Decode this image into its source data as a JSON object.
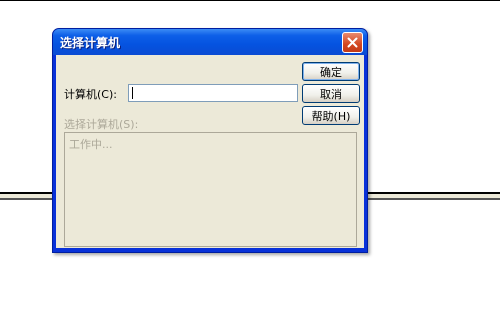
{
  "window": {
    "title": "选择计算机"
  },
  "form": {
    "computer_label": "计算机(C):",
    "computer_value": "",
    "select_label": "选择计算机(S):",
    "list_status": "工作中..."
  },
  "buttons": {
    "ok": "确定",
    "cancel": "取消",
    "help": "帮助(H)"
  },
  "icons": {
    "close": "close-icon"
  },
  "colors": {
    "titlebar": "#0553e0",
    "dialog_face": "#ece9d8",
    "close_button": "#d2461f",
    "disabled_text": "#aca899"
  }
}
